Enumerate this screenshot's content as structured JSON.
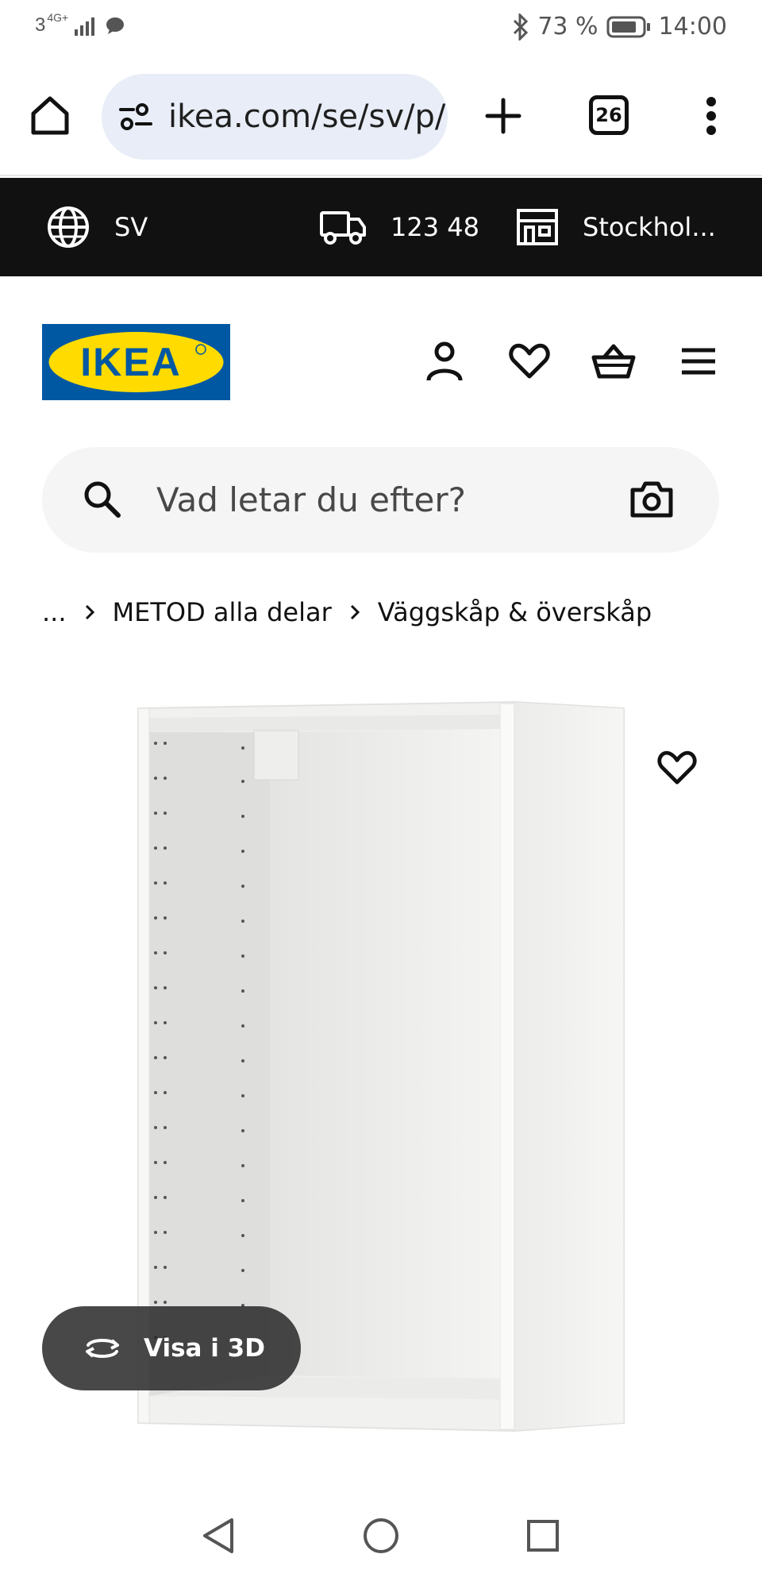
{
  "status_bar": {
    "network": "3",
    "network_type": "4G+",
    "battery_percent": "73 %",
    "time": "14:00",
    "icons": [
      "signal-icon",
      "chat-icon",
      "bluetooth-icon",
      "battery-icon"
    ]
  },
  "browser": {
    "url": "ikea.com/se/sv/p/",
    "tab_count": "26",
    "icons": [
      "home-icon",
      "site-settings-icon",
      "plus-icon",
      "tabs-icon",
      "more-icon"
    ]
  },
  "info_bar": {
    "language": "SV",
    "postal_code": "123 48",
    "store": "Stockhol...",
    "icons": [
      "globe-icon",
      "truck-icon",
      "store-icon"
    ]
  },
  "header": {
    "logo_text": "IKEA",
    "logo_colors": {
      "background": "#0058a3",
      "ellipse": "#ffdb00",
      "text": "#0058a3"
    },
    "icons": [
      "profile-icon",
      "heart-icon",
      "basket-icon",
      "menu-icon"
    ]
  },
  "search": {
    "placeholder": "Vad letar du efter?",
    "value": "",
    "icons": [
      "search-icon",
      "camera-icon"
    ]
  },
  "breadcrumb": {
    "items": [
      "...",
      "METOD alla delar",
      "Väggskåp & överskåp"
    ]
  },
  "product": {
    "image": "white wall cabinet frame",
    "view_3d_label": "Visa i 3D",
    "icons": [
      "favourite-heart-icon",
      "rotate-3d-icon"
    ]
  },
  "nav_bar": {
    "icons": [
      "back-icon",
      "home-circle-icon",
      "recents-icon"
    ]
  },
  "colors": {
    "info_bar_bg": "#111111",
    "url_pill_bg": "#e8edf7",
    "search_bg": "#f5f5f5",
    "view3d_bg": "#3a3a3a"
  }
}
